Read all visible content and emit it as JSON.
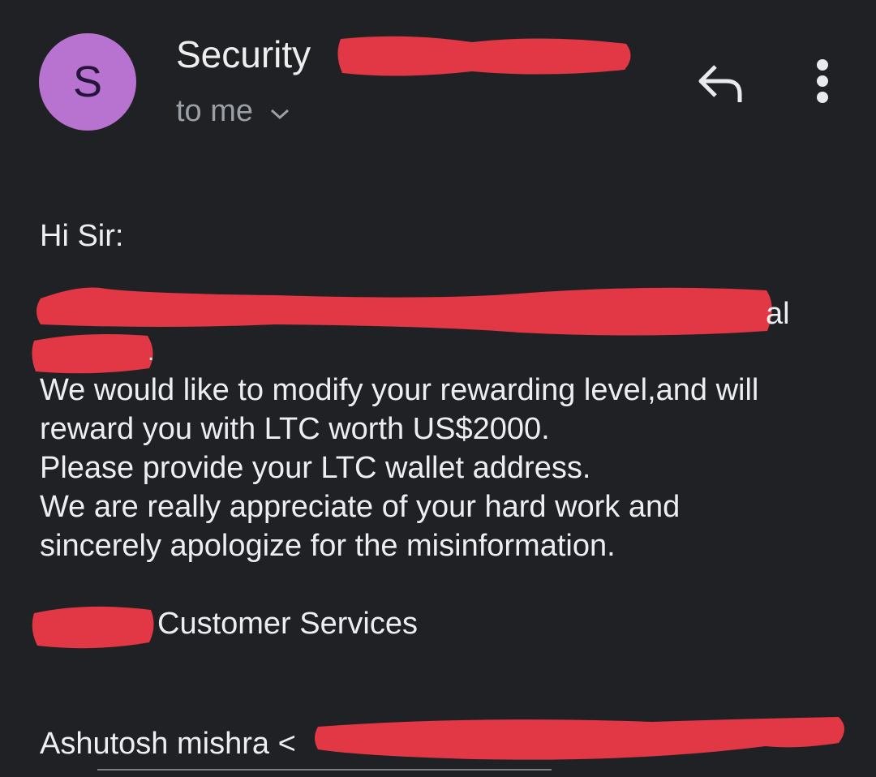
{
  "header": {
    "avatar_letter": "S",
    "sender_name": "Security",
    "recipient_label": "to me"
  },
  "body": {
    "greeting": "Hi Sir:",
    "line2_tail": "al",
    "line3_tail": ".",
    "paragraph": [
      "We would like to modify your rewarding level,and will",
      "reward you with LTC worth US$2000.",
      "Please provide your LTC wallet address.",
      "We are really appreciate of your hard work and",
      "sincerely apologize for the misinformation."
    ],
    "signature": "Customer Services",
    "quoted_sender": "Ashutosh mishra <"
  },
  "colors": {
    "background": "#202124",
    "avatar": "#b872cf",
    "redaction": "#e23744",
    "secondary_text": "#9aa0a6"
  },
  "icons": [
    "reply-icon",
    "more-vert-icon",
    "chevron-down-icon"
  ]
}
